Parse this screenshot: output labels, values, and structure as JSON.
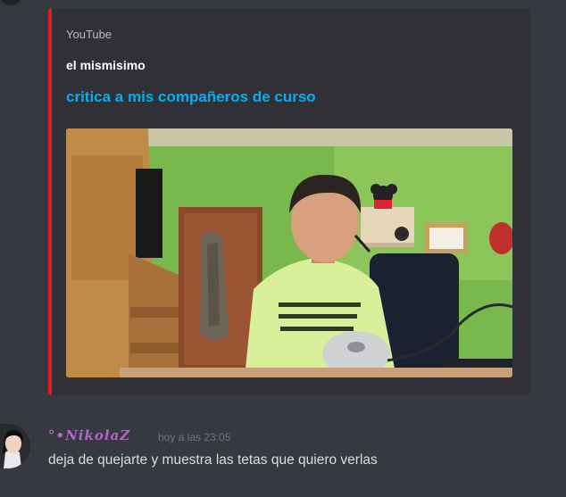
{
  "embed": {
    "provider": "YouTube",
    "author": "el mismisimo",
    "title": "critica a mis compañeros de curso",
    "accent_color": "#e01b24",
    "thumbnail": "video-thumbnail"
  },
  "message": {
    "username": "°•𝑵𝒊𝒌𝒐𝒍𝒂𝒁",
    "username_color": "#b266c7",
    "timestamp": "hoy a las 23:05",
    "content": "deja de quejarte y muestra las tetas que quiero verlas"
  }
}
